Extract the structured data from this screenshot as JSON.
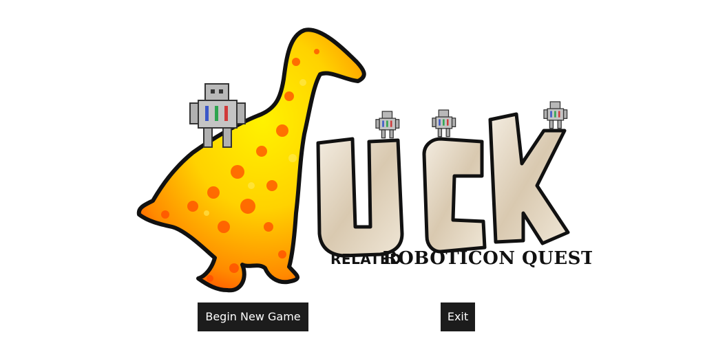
{
  "logo": {
    "letters": "UCK",
    "subtitle_left": "RELATED",
    "subtitle_right": "ROBOTICON QUEST"
  },
  "menu": {
    "begin_label": "Begin New Game",
    "exit_label": "Exit"
  },
  "colors": {
    "background": "#ffffff",
    "button_bg": "#1c1c1c",
    "button_text": "#ffffff",
    "duck_yellow": "#ffe000",
    "duck_orange": "#ff6a00",
    "letter_fill": "#ece2d2",
    "robot_gray": "#b8b8b8"
  }
}
